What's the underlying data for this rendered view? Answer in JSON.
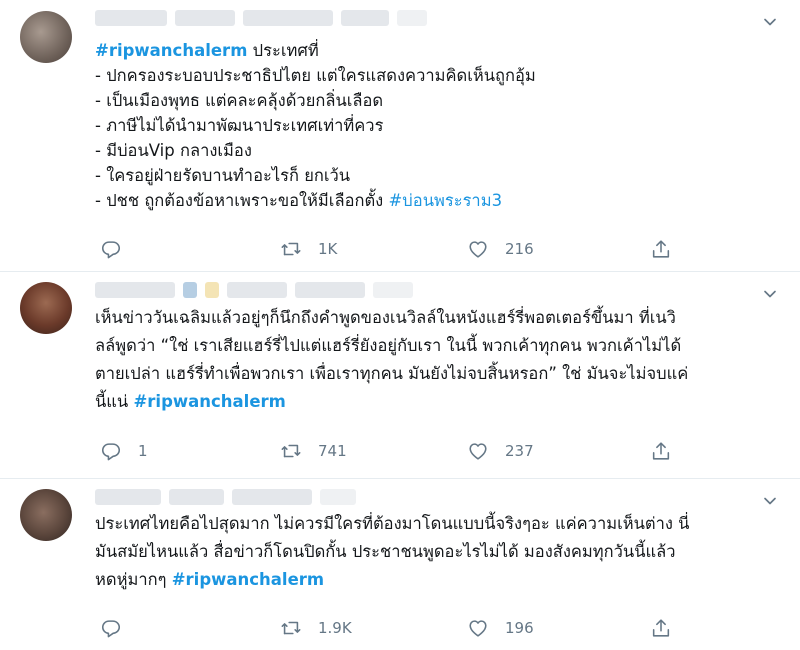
{
  "tweets": [
    {
      "lines": [
        {
          "parts": [
            {
              "t": "#ripwanchalerm",
              "tag": true
            },
            {
              "t": " ประเทศที่"
            }
          ]
        },
        {
          "parts": [
            {
              "t": "- ปกครองระบอบประชาธิปไตย แต่ใครแสดงความคิดเห็นถูกอุ้ม"
            }
          ]
        },
        {
          "parts": [
            {
              "t": "- เป็นเมืองพุทธ แต่คละคลุ้งด้วยกลิ่นเลือด"
            }
          ]
        },
        {
          "parts": [
            {
              "t": "- ภาษีไม่ได้นำมาพัฒนาประเทศเท่าที่ควร"
            }
          ]
        },
        {
          "parts": [
            {
              "t": "- มีบ่อนVip กลางเมือง"
            }
          ]
        },
        {
          "parts": [
            {
              "t": "- ใครอยู่ฝ่ายรัดบานทำอะไรก็ ยกเว้น"
            }
          ]
        },
        {
          "parts": [
            {
              "t": "- ปชช ถูกต้องข้อหาเพราะขอให้มีเลือกตั้ง "
            },
            {
              "t": "#บ่อนพระราม3",
              "tag2": true
            }
          ]
        }
      ],
      "reply_count": "",
      "retweet_count": "1K",
      "like_count": "216"
    },
    {
      "lines": [
        {
          "parts": [
            {
              "t": "เห็นข่าววันเฉลิมแล้วอยู่ๆก็นึกถึงคำพูดของเนวิลล์ในหนังแฮร์รี่พอตเตอร์ขึ้นมา ที่เนวิ"
            }
          ]
        },
        {
          "parts": [
            {
              "t": "ลล์พูดว่า “ใช่ เราเสียแฮร์รี่ไปแต่แฮร์รี่ยังอยู่กับเรา ในนี้ พวกเค้าทุกคน พวกเค้าไม่ได้"
            }
          ]
        },
        {
          "parts": [
            {
              "t": "ตายเปล่า แฮร์รี่ทำเพื่อพวกเรา เพื่อเราทุกคน มันยังไม่จบสิ้นหรอก” ใช่ มันจะไม่จบแค่"
            }
          ]
        },
        {
          "parts": [
            {
              "t": "นี้แน่ "
            },
            {
              "t": "#ripwanchalerm",
              "tag": true
            }
          ]
        }
      ],
      "reply_count": "1",
      "retweet_count": "741",
      "like_count": "237"
    },
    {
      "lines": [
        {
          "parts": [
            {
              "t": "ประเทศไทยคือไปสุดมาก ไม่ควรมีใครที่ต้องมาโดนแบบนี้จริงๆอะ แค่ความเห็นต่าง นี่"
            }
          ]
        },
        {
          "parts": [
            {
              "t": "มันสมัยไหนแล้ว สื่อข่าวก็โดนปิดกั้น ประชาชนพูดอะไรไม่ได้ มองสังคมทุกวันนี้แล้ว"
            }
          ]
        },
        {
          "parts": [
            {
              "t": "หดหู่มากๆ "
            },
            {
              "t": "#ripwanchalerm",
              "tag": true
            }
          ]
        }
      ],
      "reply_count": "",
      "retweet_count": "1.9K",
      "like_count": "196"
    }
  ],
  "icons": {
    "reply": "reply-icon",
    "retweet": "retweet-icon",
    "like": "heart-icon",
    "share": "share-icon",
    "more": "chevron-down-icon"
  },
  "colors": {
    "hashtag": "#1b95e0",
    "text": "#14171a",
    "icon": "#657786",
    "divider": "#e6ecf0"
  }
}
